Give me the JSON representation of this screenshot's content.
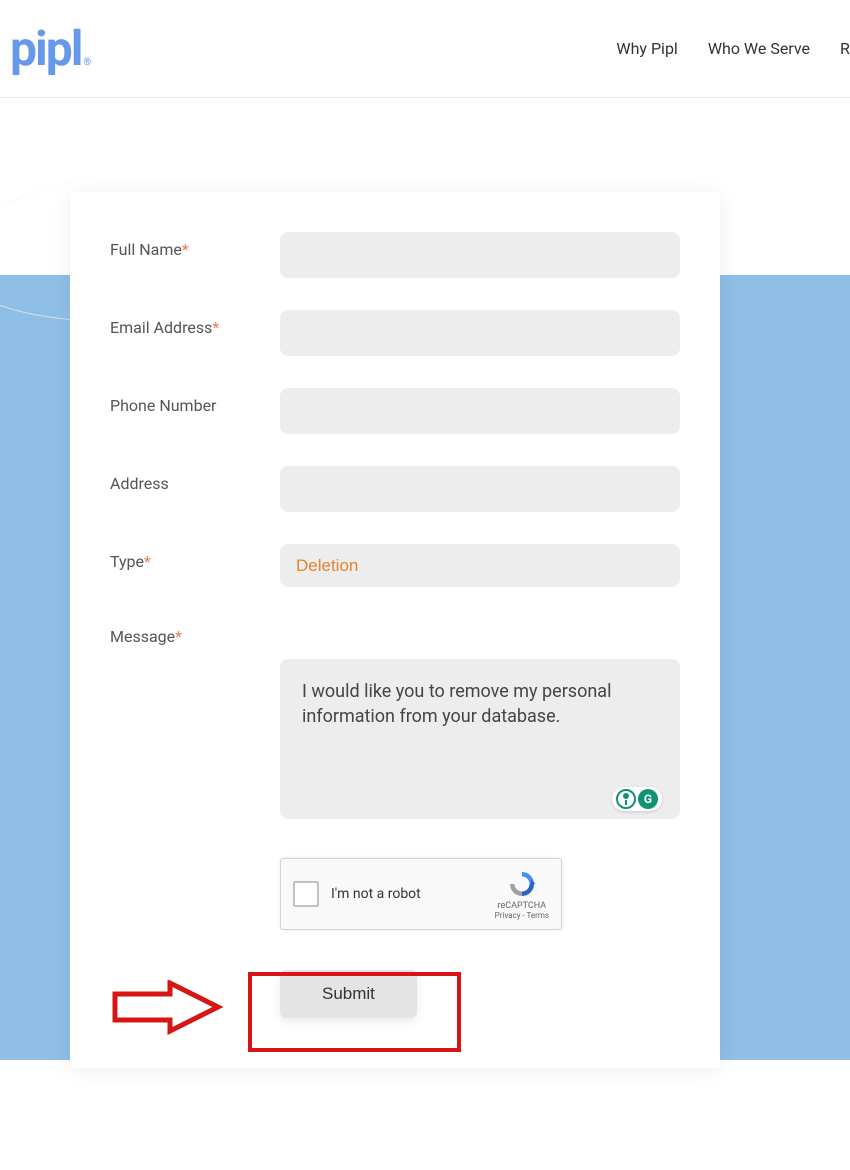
{
  "header": {
    "logo_text": "pipl",
    "logo_reg": "®",
    "nav": {
      "why": "Why Pipl",
      "who": "Who We Serve",
      "partial": "R"
    }
  },
  "form": {
    "labels": {
      "full_name": "Full Name",
      "email": "Email Address",
      "phone": "Phone Number",
      "address": "Address",
      "type": "Type",
      "message": "Message"
    },
    "values": {
      "full_name": "",
      "email": "",
      "phone": "",
      "address": "",
      "type": "Deletion",
      "message": "I would like you to remove my personal information from your database."
    },
    "required_marker": "*"
  },
  "recaptcha": {
    "label": "I'm not a robot",
    "brand": "reCAPTCHA",
    "links": "Privacy - Terms"
  },
  "submit": {
    "label": "Submit"
  },
  "grammarly": {
    "icon_letter": "G"
  }
}
